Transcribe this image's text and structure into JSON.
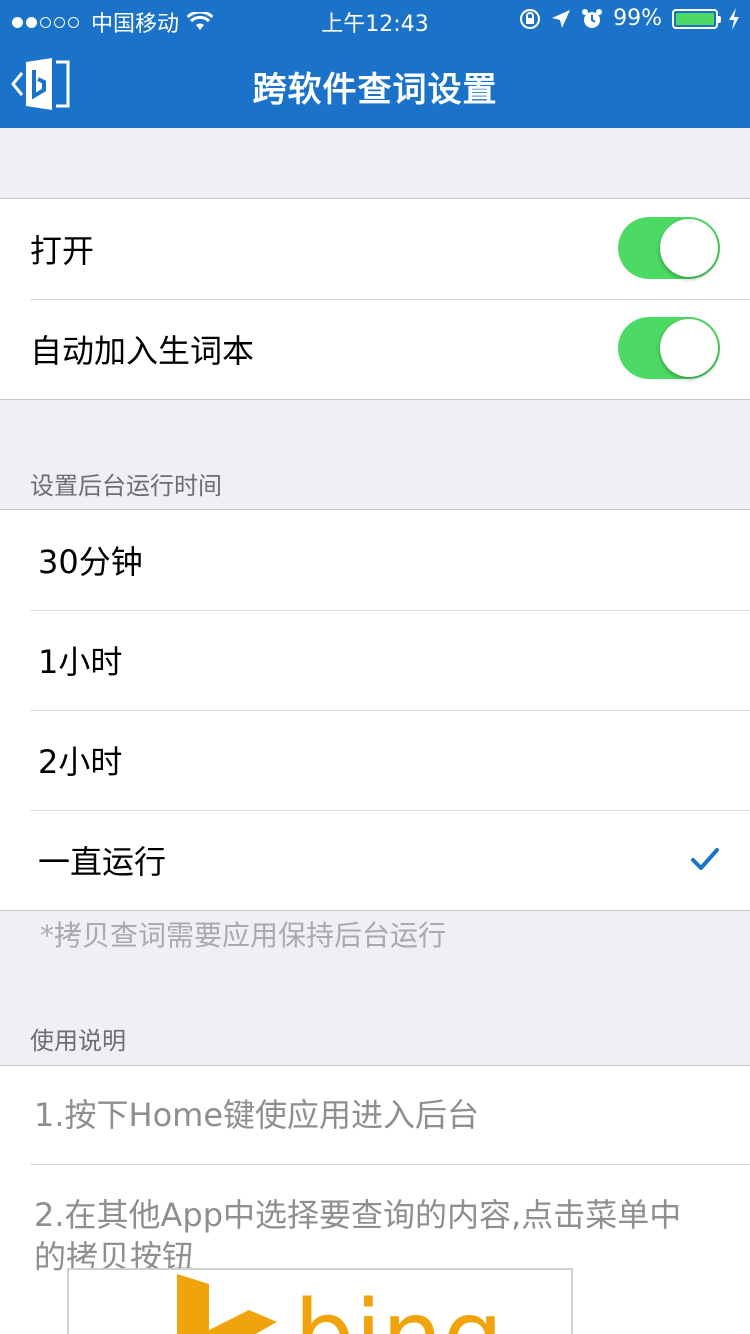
{
  "status_bar": {
    "carrier": "中国移动",
    "time": "上午12:43",
    "battery_percent": "99%",
    "battery_level": 0.99
  },
  "nav": {
    "title": "跨软件查词设置"
  },
  "toggles_group": {
    "items": [
      {
        "label": "打开",
        "on": true
      },
      {
        "label": "自动加入生词本",
        "on": true
      }
    ]
  },
  "runtime_section": {
    "header": "设置后台运行时间",
    "options": [
      {
        "label": "30分钟",
        "selected": false
      },
      {
        "label": "1小时",
        "selected": false
      },
      {
        "label": "2小时",
        "selected": false
      },
      {
        "label": "一直运行",
        "selected": true
      }
    ],
    "footer": "*拷贝查词需要应用保持后台运行"
  },
  "help_section": {
    "header": "使用说明",
    "steps": [
      "1.按下Home键使应用进入后台",
      "2.在其他App中选择要查询的内容,点击菜单中的拷贝按钮"
    ],
    "image_text": "bing"
  },
  "colors": {
    "nav_blue": "#1b73c9",
    "toggle_green": "#4cd964",
    "check_blue": "#1b73c9",
    "bing_orange": "#f0a30a"
  }
}
